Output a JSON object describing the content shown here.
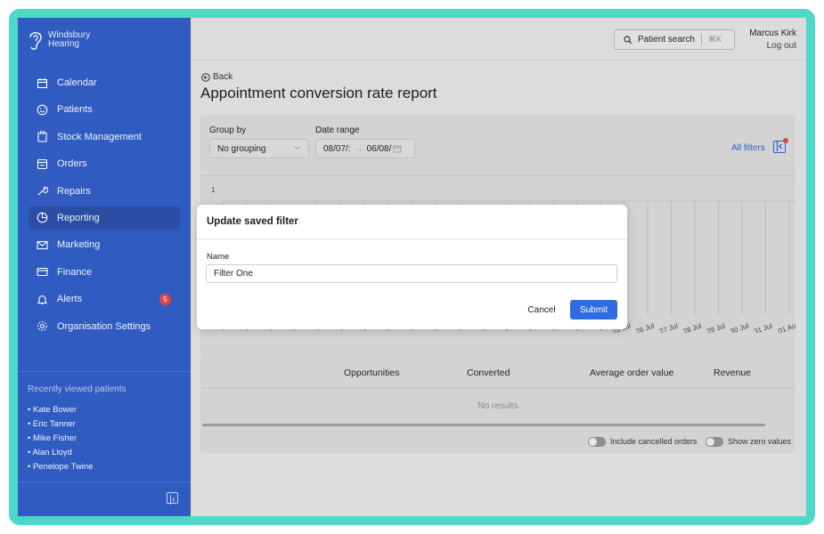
{
  "brand": {
    "name_line1": "Windsbury",
    "name_line2": "Hearing"
  },
  "sidebar": {
    "items": [
      {
        "label": "Calendar",
        "icon": "calendar-icon"
      },
      {
        "label": "Patients",
        "icon": "smile-icon"
      },
      {
        "label": "Stock Management",
        "icon": "clipboard-icon"
      },
      {
        "label": "Orders",
        "icon": "box-icon"
      },
      {
        "label": "Repairs",
        "icon": "wrench-icon"
      },
      {
        "label": "Reporting",
        "icon": "pie-chart-icon",
        "active": true
      },
      {
        "label": "Marketing",
        "icon": "mail-icon"
      },
      {
        "label": "Finance",
        "icon": "credit-card-icon"
      },
      {
        "label": "Alerts",
        "icon": "bell-icon",
        "badge": "5"
      },
      {
        "label": "Organisation Settings",
        "icon": "gear-icon"
      }
    ],
    "recent_title": "Recently viewed patients",
    "recent": [
      "• Kate Bower",
      "• Eric Tanner",
      "• Mike Fisher",
      "• Alan Lloyd",
      "• Penelope Twine"
    ]
  },
  "topbar": {
    "search_label": "Patient search",
    "search_shortcut": "⌘K",
    "user_name": "Marcus Kirk",
    "logout": "Log out"
  },
  "page": {
    "back": "Back",
    "title": "Appointment conversion rate report"
  },
  "filters": {
    "group_by_label": "Group by",
    "group_by_value": "No grouping",
    "date_range_label": "Date range",
    "date_from": "08/07/:",
    "date_to": "06/08/",
    "all_filters": "All filters"
  },
  "chart_data": {
    "type": "bar",
    "y_tick_top": "1",
    "categories": [
      "08",
      "09",
      "10",
      "11",
      "12",
      "13",
      "14",
      "15",
      "16",
      "17",
      "18",
      "19",
      "20",
      "21",
      "22",
      "23",
      "24",
      "25 Jul",
      "26 Jul",
      "27 Jul",
      "28 Jul",
      "29 Jul",
      "30 Jul",
      "31 Jul",
      "01 Au"
    ],
    "values": []
  },
  "table": {
    "columns": [
      "Opportunities",
      "Converted",
      "Average order value",
      "Revenue"
    ],
    "empty_text": "No results",
    "toggle1": "Include cancelled orders",
    "toggle2": "Show zero values"
  },
  "modal": {
    "title": "Update saved filter",
    "name_label": "Name",
    "name_value": "Filter One",
    "cancel": "Cancel",
    "submit": "Submit"
  },
  "colors": {
    "sidebar": "#305cc1",
    "accent": "#2f6be3",
    "frame": "#4fd8c8",
    "badge": "#e04545"
  }
}
